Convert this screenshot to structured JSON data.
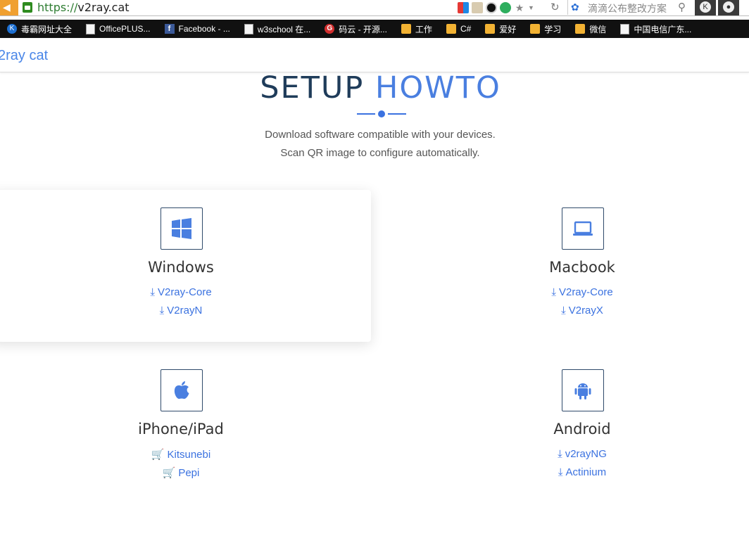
{
  "browser": {
    "url_proto": "https://",
    "url_host": "v2ray.cat",
    "search_placeholder": "滴滴公布整改方案",
    "bookmarks": [
      {
        "label": "毒霸网址大全",
        "icon": "k-icon"
      },
      {
        "label": "OfficePLUS...",
        "icon": "page-icon"
      },
      {
        "label": "Facebook - ...",
        "icon": "facebook-icon"
      },
      {
        "label": "w3school 在...",
        "icon": "page-icon"
      },
      {
        "label": "码云 - 开源...",
        "icon": "gitee-icon"
      },
      {
        "label": "工作",
        "icon": "folder-icon"
      },
      {
        "label": "C#",
        "icon": "folder-icon"
      },
      {
        "label": "爱好",
        "icon": "folder-icon"
      },
      {
        "label": "学习",
        "icon": "folder-icon"
      },
      {
        "label": "微信",
        "icon": "folder-icon"
      },
      {
        "label": "中国电信广东...",
        "icon": "page-icon"
      }
    ]
  },
  "site": {
    "brand": "2ray cat"
  },
  "section": {
    "title_main": "SETUP",
    "title_highlight": "HOWTO",
    "desc_line1": "Download software compatible with your devices.",
    "desc_line2": "Scan QR image to configure automatically."
  },
  "platforms": [
    {
      "name": "Windows",
      "icon": "windows-icon",
      "links": [
        "V2ray-Core",
        "V2rayN"
      ],
      "link_icon": "download-icon"
    },
    {
      "name": "Macbook",
      "icon": "laptop-icon",
      "links": [
        "V2ray-Core",
        "V2rayX"
      ],
      "link_icon": "download-icon"
    },
    {
      "name": "iPhone/iPad",
      "icon": "apple-icon",
      "links": [
        "Kitsunebi",
        "Pepi"
      ],
      "link_icon": "cart-icon"
    },
    {
      "name": "Android",
      "icon": "android-icon",
      "links": [
        "v2rayNG",
        "Actinium"
      ],
      "link_icon": "download-icon"
    }
  ],
  "colors": {
    "accent": "#3b72e0",
    "title": "#1f3c5a"
  }
}
